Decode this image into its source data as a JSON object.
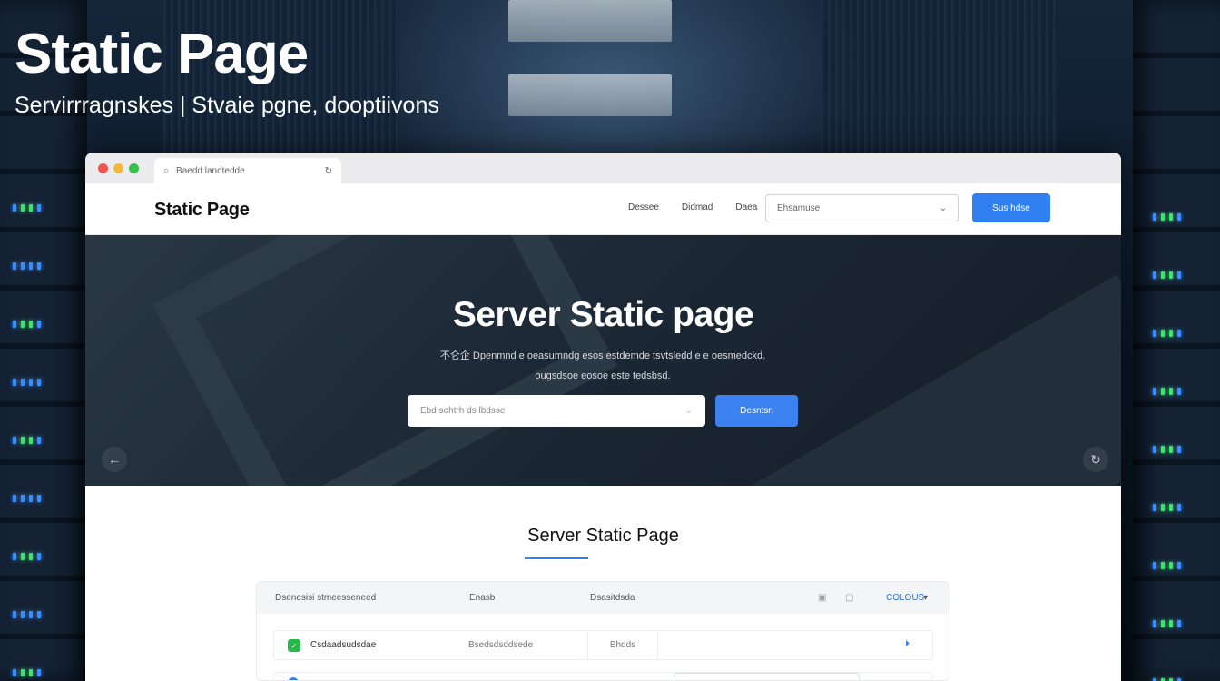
{
  "overlay": {
    "title": "Static Page",
    "subtitle": "Servirrragnskes | Stvaie pgne, dooptiivons"
  },
  "browser": {
    "tab_label": "Baedd landtedde",
    "tab_icon": "circle-icon",
    "tab_action_icon": "refresh-icon"
  },
  "header": {
    "logo": "Static Page",
    "nav": [
      "Dessee",
      "Didmad",
      "Daea"
    ],
    "select_value": "Ehsamuse",
    "select_icon": "chevron-down-icon",
    "button_label": "Sus hdse"
  },
  "hero": {
    "title": "Server Static page",
    "description_line1": "不仑企 Dpenmnd e oeasumndg esos estdemde tsvtsledd e e oesmedckd.",
    "description_line2": "ougsdsoe eosoe este tedsbsd.",
    "input_placeholder": "Ebd sohtrh ds lbdsse",
    "button_label": "Desntsn",
    "prev_arrow": "←",
    "next_arrow": "↻"
  },
  "section": {
    "title": "Server Static Page"
  },
  "table": {
    "headers": [
      "Dsenesisi stmeesseneed",
      "Enasb",
      "Dsasitdsda"
    ],
    "status_label": "COLOUS",
    "caret": "▾",
    "row": {
      "name": "Csdaadsudsdae",
      "col2": "Bsedsdsddsede",
      "col3": "Bhdds",
      "action": "⏵"
    }
  },
  "colors": {
    "accent": "#2f7ff0",
    "hero_bg": "#1c2835",
    "led_green": "#3de36b",
    "led_blue": "#3a8dff"
  }
}
